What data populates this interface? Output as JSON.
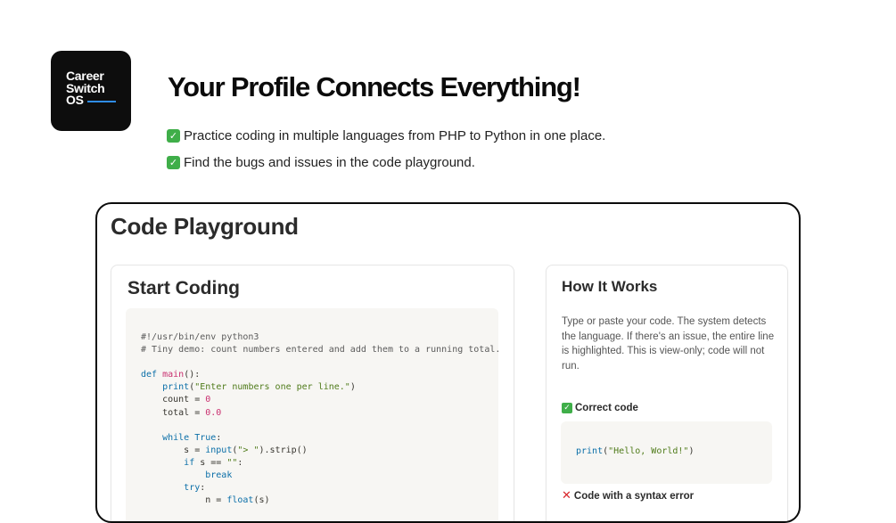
{
  "logo": {
    "line1": "Career",
    "line2": "Switch",
    "line3": "OS",
    "accent": "#2f8ce8"
  },
  "headline": "Your Profile Connects Everything!",
  "bullets": [
    "Practice coding in multiple languages from PHP to Python in one place.",
    "Find the bugs and issues in the code playground."
  ],
  "playground": {
    "title": "Code Playground",
    "editor": {
      "title": "Start Coding",
      "lines": [
        "#!/usr/bin/env python3",
        "# Tiny demo: count numbers entered and add them to a running total.",
        "",
        "def main():",
        "    print(\"Enter numbers one per line.\")",
        "    count = 0",
        "    total = 0.0",
        "",
        "    while True:",
        "        s = input(\"> \").strip()",
        "        if s == \"\":",
        "            break",
        "        try:",
        "            n = float(s)"
      ]
    },
    "how_it_works": {
      "title": "How It Works",
      "description": "Type or paste your code. The system detects the language. If there's an issue, the entire line is highlighted. This is view-only; code will not run.",
      "correct_label": "Correct code",
      "correct_example": "print(\"Hello, World!\")",
      "error_label": "Code with a syntax error"
    }
  },
  "colors": {
    "check": "#3fae49",
    "cross": "#d9262b",
    "code_bg": "#f7f6f3"
  }
}
